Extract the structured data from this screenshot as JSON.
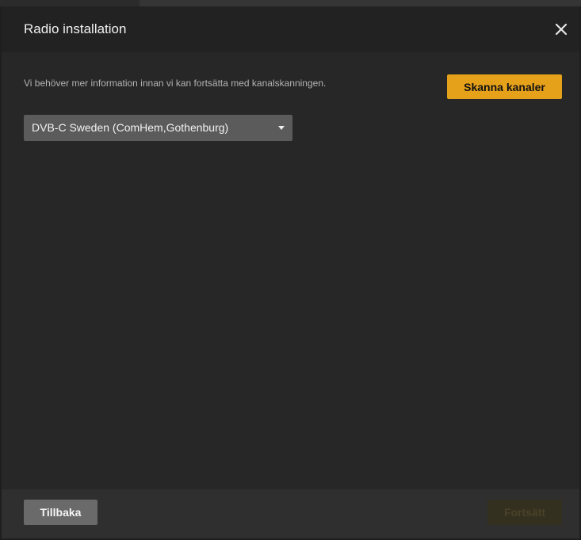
{
  "dialog": {
    "title": "Radio installation",
    "close_icon": "close-icon"
  },
  "body": {
    "info_text": "Vi behöver mer information innan vi kan fortsätta med kanalskanningen.",
    "scan_button_label": "Skanna kanaler",
    "region_select": {
      "selected": "DVB-C Sweden (ComHem,Gothenburg)",
      "icon": "chevron-down-icon"
    }
  },
  "footer": {
    "back_label": "Tillbaka",
    "continue_label": "Fortsätt"
  },
  "colors": {
    "accent": "#e5a11a",
    "dialog_bg": "#272727",
    "header_bg": "#222222",
    "footer_bg": "#2f2f2f"
  }
}
